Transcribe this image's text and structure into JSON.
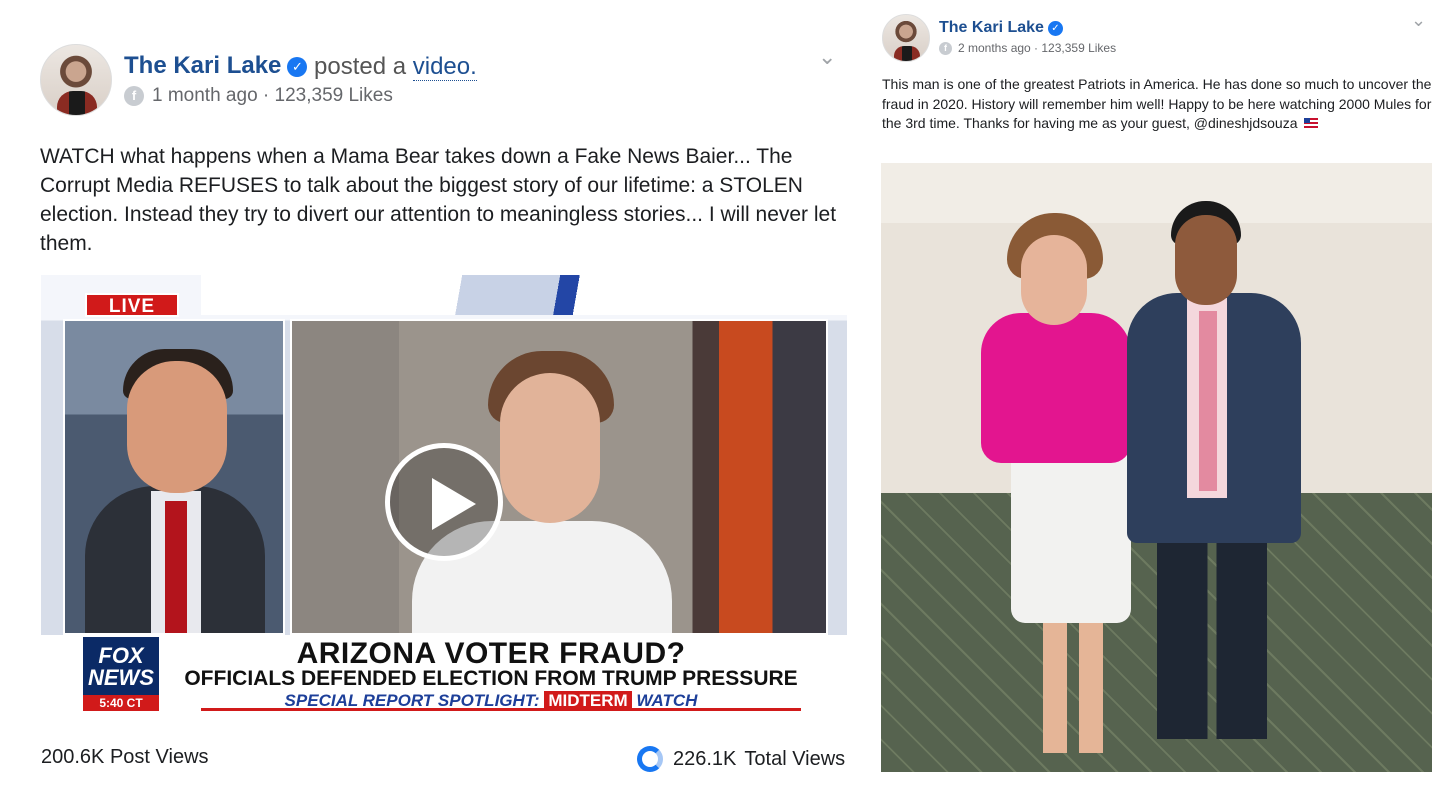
{
  "left_post": {
    "author": "The Kari Lake",
    "verified_symbol": "✓",
    "posted_prefix": "posted a",
    "posted_link": "video.",
    "privacy_symbol": "f",
    "time": "1 month ago",
    "likes": "123,359 Likes",
    "text": "WATCH what happens when a Mama Bear takes down a Fake News Baier... The Corrupt Media REFUSES to talk about the biggest story of our lifetime: a STOLEN election. Instead they try to divert our attention to meaningless stories... I will never let them.",
    "video": {
      "live_label": "LIVE",
      "network_line1": "FOX",
      "network_line2": "NEWS",
      "clock": "5:40 CT",
      "headline": "ARIZONA VOTER FRAUD?",
      "subheadline": "OFFICIALS DEFENDED ELECTION FROM TRUMP PRESSURE",
      "ticker_prefix": "SPECIAL REPORT SPOTLIGHT:",
      "ticker_tag": "MIDTERM",
      "ticker_suffix": "WATCH"
    },
    "post_views_value": "200.6K",
    "post_views_label": "Post Views",
    "total_views_value": "226.1K",
    "total_views_label": "Total Views"
  },
  "right_post": {
    "author": "The Kari Lake",
    "verified_symbol": "✓",
    "privacy_symbol": "f",
    "meta": "2 months ago · 123,359 Likes",
    "text": "This man is one of the greatest Patriots in America. He has done so much to uncover the fraud in 2020. History will remember him well! Happy to be here watching 2000 Mules for the 3rd time. Thanks for having me as your guest, @dineshjdsouza"
  },
  "icons": {
    "chevron": "⌄",
    "globe": "globe-icon",
    "verified": "verified-badge-icon",
    "play": "play-icon",
    "views_ring": "views-ring-icon",
    "flag": "us-flag-icon"
  },
  "colors": {
    "name_blue": "#1d4f91",
    "verified_blue": "#1877f2",
    "meta_gray": "#65676b",
    "live_red": "#d11a1a"
  }
}
